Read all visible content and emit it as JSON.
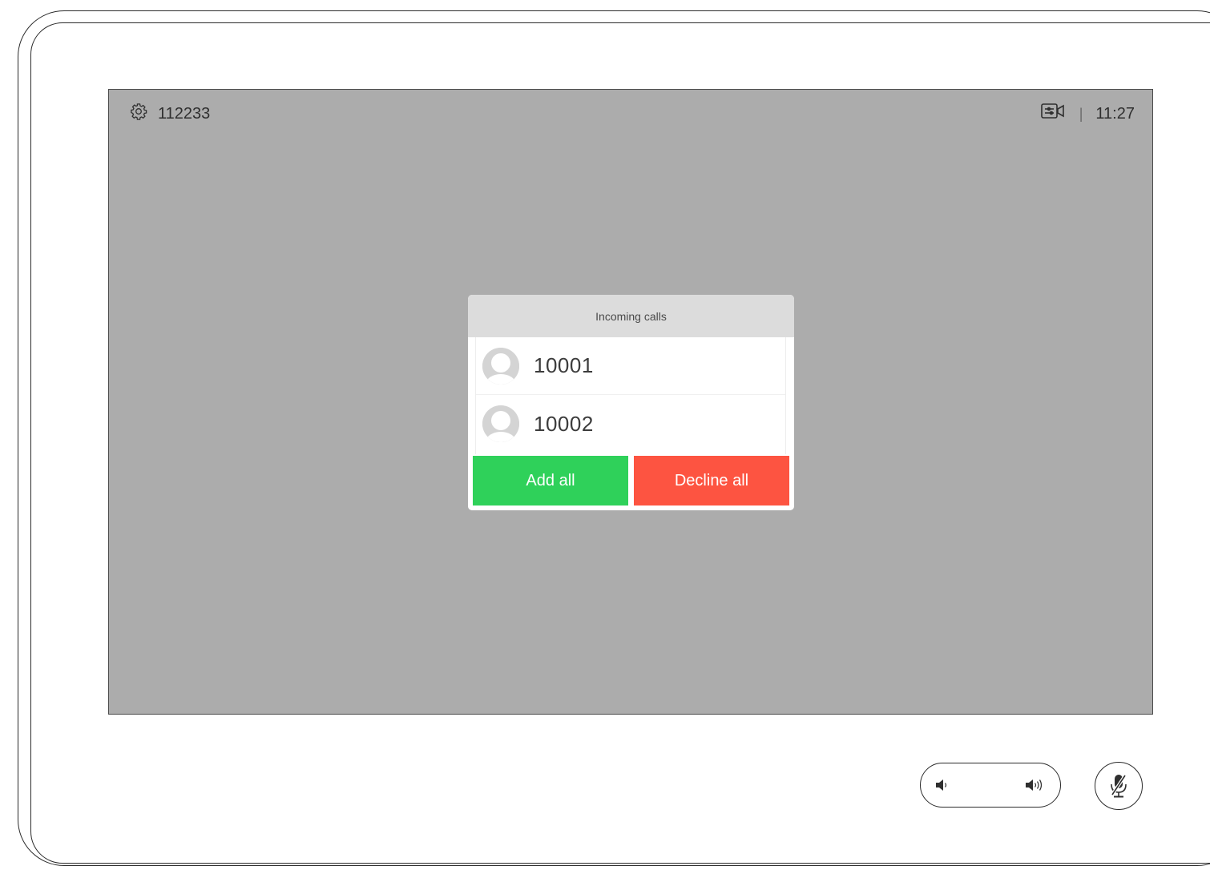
{
  "status_bar": {
    "system_name": "112233",
    "time": "11:27",
    "settings_icon": "gear-icon",
    "camera_icon": "camera-control-icon"
  },
  "incoming_dialog": {
    "title": "Incoming calls",
    "calls": [
      {
        "number": "10001",
        "icon": "avatar-placeholder-icon"
      },
      {
        "number": "10002",
        "icon": "avatar-placeholder-icon"
      }
    ],
    "add_all_label": "Add all",
    "decline_all_label": "Decline all"
  },
  "controls": {
    "volume_down_icon": "volume-down-icon",
    "volume_up_icon": "volume-up-icon",
    "mute_icon": "microphone-muted-icon"
  },
  "colors": {
    "screen_bg": "#acacac",
    "add_button": "#2fd15a",
    "decline_button": "#fd5441",
    "dialog_header": "#dcdcdc"
  }
}
